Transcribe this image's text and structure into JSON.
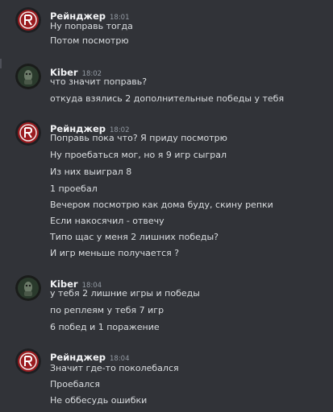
{
  "groups": [
    {
      "author": "Рейнджер",
      "time": "18:01",
      "avatar_icon": "ranger-avatar-icon",
      "lines": [
        "Ну поправь тогда",
        "Потом посмотрю"
      ]
    },
    {
      "author": "Kiber",
      "time": "18:02",
      "avatar_icon": "kiber-avatar-icon",
      "lines": [
        "что значит поправь?",
        "откуда взялись 2 дополнительные победы у тебя"
      ]
    },
    {
      "author": "Рейнджер",
      "time": "18:02",
      "avatar_icon": "ranger-avatar-icon",
      "lines": [
        "Поправь пока что? Я приду посмотрю",
        "Ну проебаться мог, но я 9 игр сыграл",
        "Из них выиграл 8",
        "1 проебал",
        "Вечером посмотрю как дома буду, скину репки",
        "Если накосячил - отвечу",
        "Типо щас у меня 2 лишних победы?",
        "И игр меньше получается ?"
      ]
    },
    {
      "author": "Kiber",
      "time": "18:04",
      "avatar_icon": "kiber-avatar-icon",
      "lines": [
        "у тебя 2 лишние игры и победы",
        "по реплеям у тебя 7 игр",
        "6 побед и 1 поражение"
      ]
    },
    {
      "author": "Рейнджер",
      "time": "18:04",
      "avatar_icon": "ranger-avatar-icon",
      "lines": [
        "Значит где-то поколебался",
        "Проебался",
        "Не оббесудь ошибки"
      ]
    }
  ],
  "colors": {
    "background": "#313338",
    "ranger_avatar": "#9b1b1f",
    "kiber_avatar": "#2a3a2c"
  }
}
